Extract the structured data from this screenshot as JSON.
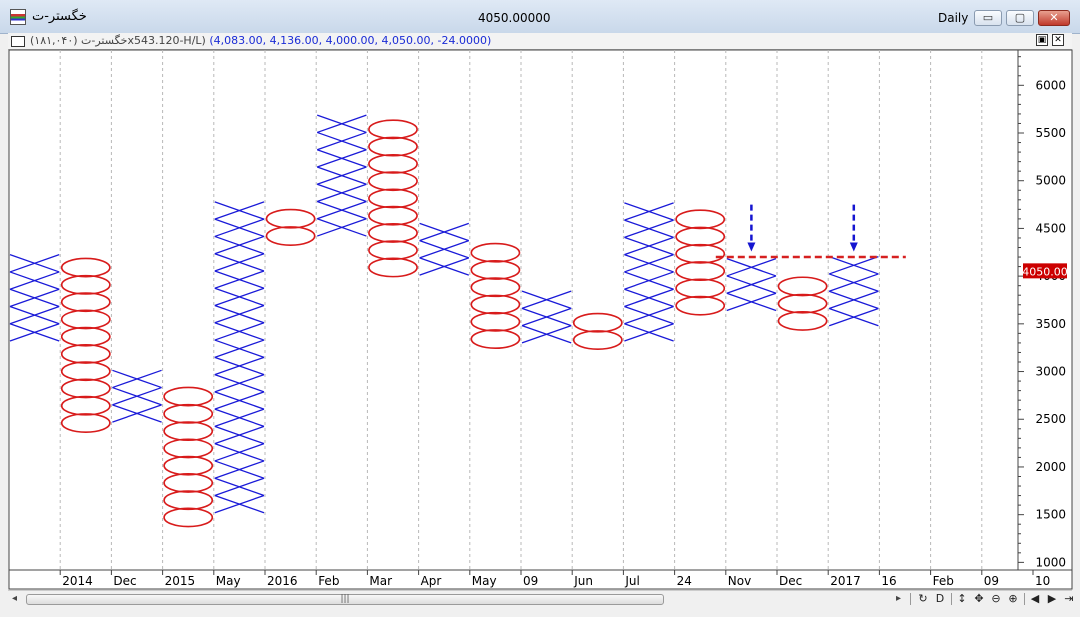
{
  "window": {
    "symbol_title": "خگستر-ت",
    "price_title": "4050.00000",
    "period_title": "Daily",
    "btn_minimize": "▭",
    "btn_restore": "▢",
    "btn_close": "✕"
  },
  "info_bar": {
    "symbol_text": "خگستر-ت (۱۸۱,۰۴۰)x543.120-H/L)",
    "values_text": "(4,083.00, 4,136.00, 4,000.00, 4,050.00, -24.0000)",
    "btn_restore": "▣",
    "btn_close": "✕"
  },
  "chart_data": {
    "type": "point-and-figure",
    "price_axis": {
      "ticks": [
        1000,
        1500,
        2000,
        2500,
        3000,
        3500,
        4000,
        4500,
        5000,
        5500,
        6000
      ],
      "range": [
        920,
        6370
      ]
    },
    "current_price_label": "4050.00",
    "time_axis_labels": [
      "2014",
      "Dec",
      "2015",
      "May",
      "2016",
      "Feb",
      "Mar",
      "Apr",
      "May",
      "09",
      "Jun",
      "Jul",
      "24",
      "Nov",
      "Dec",
      "2017",
      "16",
      "Feb",
      "09",
      "10"
    ],
    "box_size": 181,
    "columns": [
      {
        "type": "X",
        "low": 3320,
        "high": 4310
      },
      {
        "type": "O",
        "low": 2370,
        "high": 4110
      },
      {
        "type": "X",
        "low": 2470,
        "high": 3030
      },
      {
        "type": "O",
        "low": 1380,
        "high": 2810
      },
      {
        "type": "X",
        "low": 1520,
        "high": 4850
      },
      {
        "type": "O",
        "low": 4330,
        "high": 4650
      },
      {
        "type": "X",
        "low": 4420,
        "high": 5770
      },
      {
        "type": "O",
        "low": 4000,
        "high": 5560
      },
      {
        "type": "X",
        "low": 4010,
        "high": 4490
      },
      {
        "type": "O",
        "low": 3250,
        "high": 4270
      },
      {
        "type": "X",
        "low": 3300,
        "high": 3760
      },
      {
        "type": "O",
        "low": 3240,
        "high": 3560
      },
      {
        "type": "X",
        "low": 3320,
        "high": 4850
      },
      {
        "type": "O",
        "low": 3600,
        "high": 4640
      },
      {
        "type": "X",
        "low": 3640,
        "high": 4130
      },
      {
        "type": "O",
        "low": 3440,
        "high": 3920
      },
      {
        "type": "X",
        "low": 3480,
        "high": 4130
      }
    ],
    "annotations": [
      {
        "type": "resistance-line",
        "price": 4200,
        "color": "#d62020",
        "style": "dashed"
      },
      {
        "type": "down-arrow",
        "column": 14,
        "color": "#1515d0"
      },
      {
        "type": "down-arrow",
        "column": 16,
        "color": "#1515d0"
      }
    ],
    "colors": {
      "x": "#1a1ad8",
      "o": "#d81b1b",
      "price_label_bg": "#cc0000",
      "grid": "#b8b8b8"
    }
  },
  "bottom_toolbar": {
    "thumb_grip": "|||",
    "left_arrow": "◂",
    "right_arrow": "▸",
    "tools": [
      {
        "name": "refresh-icon",
        "glyph": "↻"
      },
      {
        "name": "date-tool-icon",
        "glyph": "D"
      },
      {
        "name": "vertical-resize-icon",
        "glyph": "↕"
      },
      {
        "name": "move-icon",
        "glyph": "✥"
      },
      {
        "name": "zoom-out-icon",
        "glyph": "⊖"
      },
      {
        "name": "zoom-in-icon",
        "glyph": "⊕"
      },
      {
        "name": "scroll-left-icon",
        "glyph": "◀"
      },
      {
        "name": "scroll-right-icon",
        "glyph": "▶"
      },
      {
        "name": "end-icon",
        "glyph": "⇥"
      }
    ]
  }
}
